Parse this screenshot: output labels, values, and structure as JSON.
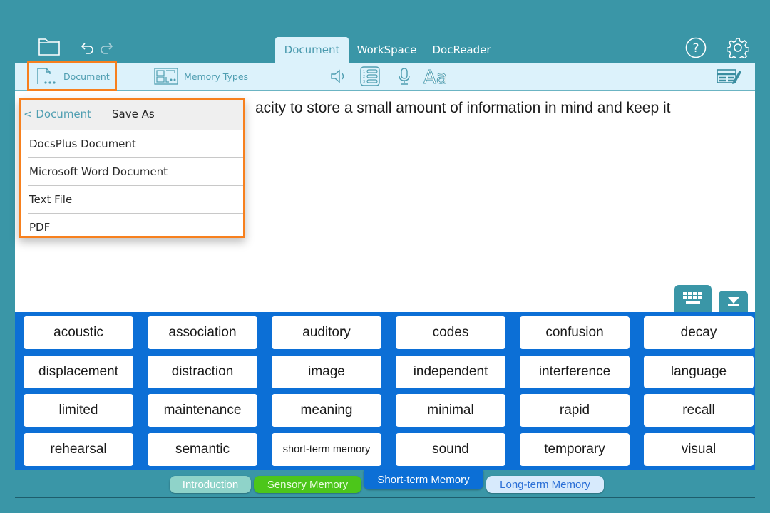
{
  "topbar": {
    "icons": {
      "open_folder": "folder-icon",
      "undo": "undo-icon",
      "redo": "redo-icon",
      "help": "help-icon",
      "settings": "gear-icon"
    },
    "tabs": [
      {
        "label": "Document",
        "active": true
      },
      {
        "label": "WorkSpace",
        "active": false
      },
      {
        "label": "DocReader",
        "active": false
      }
    ]
  },
  "toolbar": {
    "document_label": "Document",
    "memory_types_label": "Memory Types",
    "icons": [
      "document-menu-icon",
      "memory-types-icon",
      "speaker-icon",
      "numbered-list-icon",
      "microphone-icon",
      "font-icon",
      "edit-grid-icon"
    ]
  },
  "document": {
    "visible_text": "acity to store a small amount of information in mind and keep it"
  },
  "menu": {
    "back_label": "< Document",
    "title": "Save As",
    "items": [
      "DocsPlus Document",
      "Microsoft Word Document",
      "Text File",
      "PDF"
    ]
  },
  "keyboard": {
    "keyboard_icon": "keyboard-icon",
    "collapse_icon": "collapse-down-icon"
  },
  "wordbank": {
    "words": [
      "acoustic",
      "association",
      "auditory",
      "codes",
      "confusion",
      "decay",
      "displacement",
      "distraction",
      "image",
      "independent",
      "interference",
      "language",
      "limited",
      "maintenance",
      "meaning",
      "minimal",
      "rapid",
      "recall",
      "rehearsal",
      "semantic",
      "short-term memory",
      "sound",
      "temporary",
      "visual"
    ]
  },
  "sections": [
    {
      "label": "Introduction",
      "color": "#8fd3c9",
      "text_color": "#ffffff"
    },
    {
      "label": "Sensory Memory",
      "color": "#4cc61a",
      "text_color": "#eafce0"
    },
    {
      "label": "Short-term Memory",
      "color": "#0c6fd6",
      "text_color": "#ffffff",
      "active": true
    },
    {
      "label": "Long-term Memory",
      "color": "#d7eafc",
      "text_color": "#2a6fd6"
    }
  ],
  "colors": {
    "app_background": "#3a96a7",
    "toolbar_background": "#dcf2fb",
    "highlight": "#f7801e",
    "wordbank_background": "#0c6fd6",
    "accent_text": "#4f9eb1"
  }
}
